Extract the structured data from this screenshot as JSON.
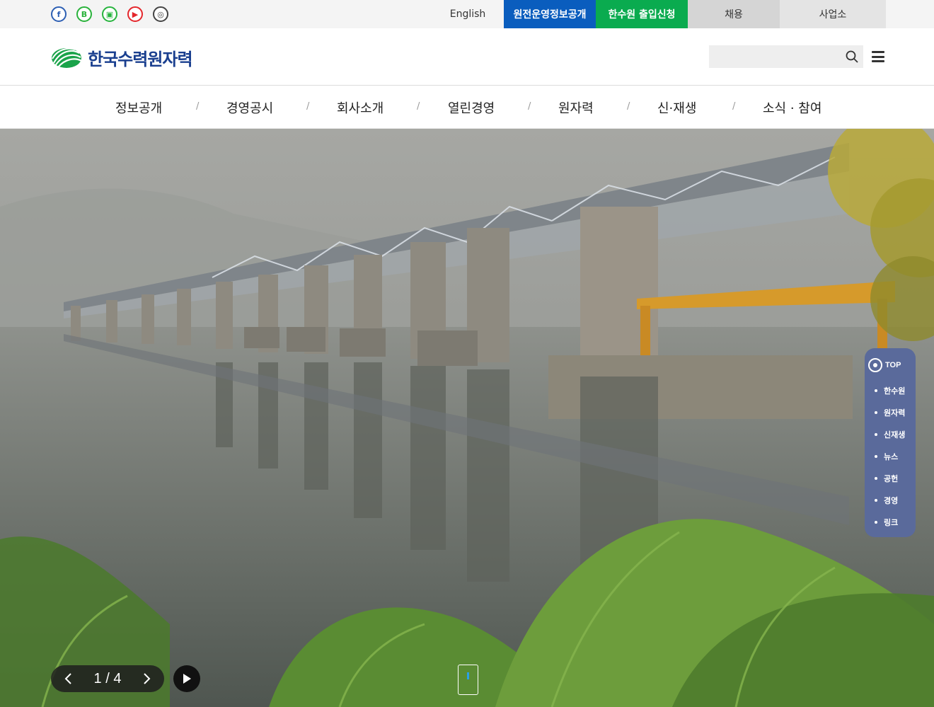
{
  "topbar": {
    "social": [
      {
        "name": "facebook",
        "glyph": "f",
        "color": "#2d5fb3"
      },
      {
        "name": "blog",
        "glyph": "B",
        "color": "#2ab23b"
      },
      {
        "name": "post",
        "glyph": "▣",
        "color": "#27b43e"
      },
      {
        "name": "youtube",
        "glyph": "▶",
        "color": "#e4262b"
      },
      {
        "name": "instagram",
        "glyph": "◎",
        "color": "#444444"
      }
    ],
    "english": "English",
    "info_disclosure": "원전운영정보공개",
    "access_request": "한수원 출입신청",
    "recruit": "채용",
    "business_site": "사업소"
  },
  "header": {
    "logo_text": "한국수력원자력",
    "search_placeholder": ""
  },
  "gnb": [
    "정보공개",
    "경영공시",
    "회사소개",
    "열린경영",
    "원자력",
    "신·재생",
    "소식 · 참여"
  ],
  "slider": {
    "counter": "1 / 4",
    "current": 1,
    "total": 4
  },
  "quick_menu": {
    "top_label": "TOP",
    "items": [
      "한수원",
      "원자력",
      "신재생",
      "뉴스",
      "공헌",
      "경영",
      "링크"
    ]
  }
}
